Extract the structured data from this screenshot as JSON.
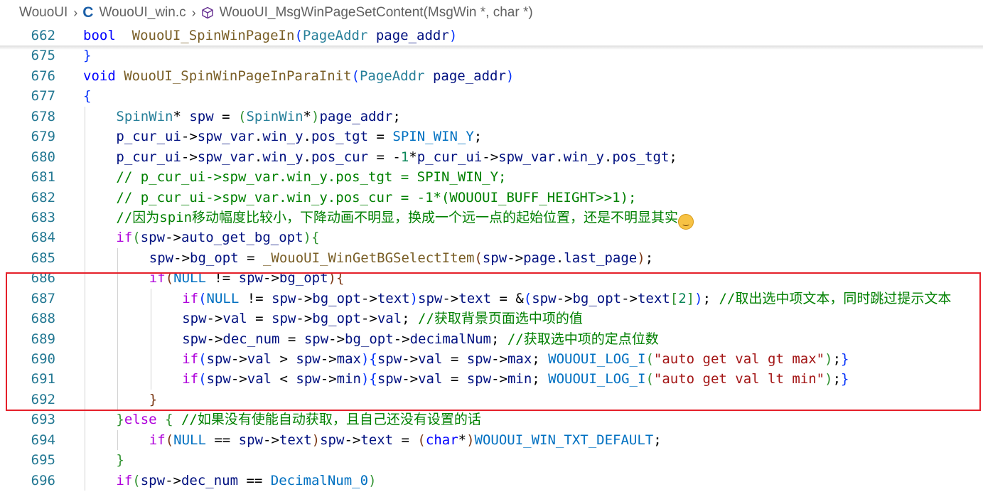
{
  "breadcrumb": {
    "folder": "WouoUI",
    "file": "WouoUI_win.c",
    "symbol": "WouoUI_MsgWinPageSetContent(MsgWin *, char *)"
  },
  "lines": [
    {
      "n": "662",
      "indent": 0,
      "tokens": [
        [
          "kw",
          "bool"
        ],
        [
          "",
          "  "
        ],
        [
          "fn",
          "WouoUI_SpinWinPageIn"
        ],
        [
          "b1",
          "("
        ],
        [
          "ty",
          "PageAddr"
        ],
        [
          "",
          " "
        ],
        [
          "var",
          "page_addr"
        ],
        [
          "b1",
          ")"
        ]
      ]
    },
    {
      "n": "675",
      "indent": 0,
      "tokens": [
        [
          "b1",
          "}"
        ]
      ]
    },
    {
      "n": "676",
      "indent": 0,
      "tokens": [
        [
          "kw",
          "void"
        ],
        [
          "",
          " "
        ],
        [
          "fn",
          "WouoUI_SpinWinPageInParaInit"
        ],
        [
          "b1",
          "("
        ],
        [
          "ty",
          "PageAddr"
        ],
        [
          "",
          " "
        ],
        [
          "var",
          "page_addr"
        ],
        [
          "b1",
          ")"
        ]
      ]
    },
    {
      "n": "677",
      "indent": 0,
      "tokens": [
        [
          "b1",
          "{"
        ]
      ]
    },
    {
      "n": "678",
      "indent": 1,
      "tokens": [
        [
          "ty",
          "SpinWin"
        ],
        [
          "",
          "* "
        ],
        [
          "var",
          "spw"
        ],
        [
          "",
          " = "
        ],
        [
          "b2",
          "("
        ],
        [
          "ty",
          "SpinWin"
        ],
        [
          "",
          "*"
        ],
        [
          "b2",
          ")"
        ],
        [
          "var",
          "page_addr"
        ],
        [
          "",
          ";"
        ]
      ]
    },
    {
      "n": "679",
      "indent": 1,
      "tokens": [
        [
          "var",
          "p_cur_ui"
        ],
        [
          "",
          "->"
        ],
        [
          "var",
          "spw_var"
        ],
        [
          "",
          "."
        ],
        [
          "var",
          "win_y"
        ],
        [
          "",
          "."
        ],
        [
          "var",
          "pos_tgt"
        ],
        [
          "",
          " = "
        ],
        [
          "mac",
          "SPIN_WIN_Y"
        ],
        [
          "",
          ";"
        ]
      ]
    },
    {
      "n": "680",
      "indent": 1,
      "tokens": [
        [
          "var",
          "p_cur_ui"
        ],
        [
          "",
          "->"
        ],
        [
          "var",
          "spw_var"
        ],
        [
          "",
          "."
        ],
        [
          "var",
          "win_y"
        ],
        [
          "",
          "."
        ],
        [
          "var",
          "pos_cur"
        ],
        [
          "",
          " = "
        ],
        [
          "",
          "-"
        ],
        [
          "num",
          "1"
        ],
        [
          "",
          "*"
        ],
        [
          "var",
          "p_cur_ui"
        ],
        [
          "",
          "->"
        ],
        [
          "var",
          "spw_var"
        ],
        [
          "",
          "."
        ],
        [
          "var",
          "win_y"
        ],
        [
          "",
          "."
        ],
        [
          "var",
          "pos_tgt"
        ],
        [
          "",
          ";"
        ]
      ]
    },
    {
      "n": "681",
      "indent": 1,
      "tokens": [
        [
          "cm",
          "// p_cur_ui->spw_var.win_y.pos_tgt = SPIN_WIN_Y;"
        ]
      ]
    },
    {
      "n": "682",
      "indent": 1,
      "tokens": [
        [
          "cm",
          "// p_cur_ui->spw_var.win_y.pos_cur = -1*(WOUOUI_BUFF_HEIGHT>>1);"
        ]
      ]
    },
    {
      "n": "683",
      "indent": 1,
      "tokens": [
        [
          "cm",
          "//因为spin移动幅度比较小，下降动画不明显，换成一个远一点的起始位置，还是不明显其实"
        ]
      ],
      "emoji": "face-with-tears-of-joy"
    },
    {
      "n": "684",
      "indent": 1,
      "tokens": [
        [
          "ctl",
          "if"
        ],
        [
          "b2",
          "("
        ],
        [
          "var",
          "spw"
        ],
        [
          "",
          "->"
        ],
        [
          "var",
          "auto_get_bg_opt"
        ],
        [
          "b2",
          ")"
        ],
        [
          "b2",
          "{"
        ]
      ]
    },
    {
      "n": "685",
      "indent": 2,
      "tokens": [
        [
          "var",
          "spw"
        ],
        [
          "",
          "->"
        ],
        [
          "var",
          "bg_opt"
        ],
        [
          "",
          " = "
        ],
        [
          "fn",
          "_WouoUI_WinGetBGSelectItem"
        ],
        [
          "b3",
          "("
        ],
        [
          "var",
          "spw"
        ],
        [
          "",
          "->"
        ],
        [
          "var",
          "page"
        ],
        [
          "",
          "."
        ],
        [
          "var",
          "last_page"
        ],
        [
          "b3",
          ")"
        ],
        [
          "",
          ";"
        ]
      ]
    },
    {
      "n": "686",
      "indent": 2,
      "tokens": [
        [
          "ctl",
          "if"
        ],
        [
          "b3",
          "("
        ],
        [
          "mac",
          "NULL"
        ],
        [
          "",
          " != "
        ],
        [
          "var",
          "spw"
        ],
        [
          "",
          "->"
        ],
        [
          "var",
          "bg_opt"
        ],
        [
          "b3",
          ")"
        ],
        [
          "b3",
          "{"
        ]
      ]
    },
    {
      "n": "687",
      "indent": 3,
      "tokens": [
        [
          "ctl",
          "if"
        ],
        [
          "b1",
          "("
        ],
        [
          "mac",
          "NULL"
        ],
        [
          "",
          " != "
        ],
        [
          "var",
          "spw"
        ],
        [
          "",
          "->"
        ],
        [
          "var",
          "bg_opt"
        ],
        [
          "",
          "->"
        ],
        [
          "var",
          "text"
        ],
        [
          "b1",
          ")"
        ],
        [
          "var",
          "spw"
        ],
        [
          "",
          "->"
        ],
        [
          "var",
          "text"
        ],
        [
          "",
          " = &"
        ],
        [
          "b1",
          "("
        ],
        [
          "var",
          "spw"
        ],
        [
          "",
          "->"
        ],
        [
          "var",
          "bg_opt"
        ],
        [
          "",
          "->"
        ],
        [
          "var",
          "text"
        ],
        [
          "b2",
          "["
        ],
        [
          "num",
          "2"
        ],
        [
          "b2",
          "]"
        ],
        [
          "b1",
          ")"
        ],
        [
          "",
          "; "
        ],
        [
          "cm",
          "//取出选中项文本，同时跳过提示文本"
        ]
      ]
    },
    {
      "n": "688",
      "indent": 3,
      "tokens": [
        [
          "var",
          "spw"
        ],
        [
          "",
          "->"
        ],
        [
          "var",
          "val"
        ],
        [
          "",
          " = "
        ],
        [
          "var",
          "spw"
        ],
        [
          "",
          "->"
        ],
        [
          "var",
          "bg_opt"
        ],
        [
          "",
          "->"
        ],
        [
          "var",
          "val"
        ],
        [
          "",
          "; "
        ],
        [
          "cm",
          "//获取背景页面选中项的值"
        ]
      ]
    },
    {
      "n": "689",
      "indent": 3,
      "tokens": [
        [
          "var",
          "spw"
        ],
        [
          "",
          "->"
        ],
        [
          "var",
          "dec_num"
        ],
        [
          "",
          " = "
        ],
        [
          "var",
          "spw"
        ],
        [
          "",
          "->"
        ],
        [
          "var",
          "bg_opt"
        ],
        [
          "",
          "->"
        ],
        [
          "var",
          "decimalNum"
        ],
        [
          "",
          "; "
        ],
        [
          "cm",
          "//获取选中项的定点位数"
        ]
      ]
    },
    {
      "n": "690",
      "indent": 3,
      "tokens": [
        [
          "ctl",
          "if"
        ],
        [
          "b1",
          "("
        ],
        [
          "var",
          "spw"
        ],
        [
          "",
          "->"
        ],
        [
          "var",
          "val"
        ],
        [
          "",
          " > "
        ],
        [
          "var",
          "spw"
        ],
        [
          "",
          "->"
        ],
        [
          "var",
          "max"
        ],
        [
          "b1",
          ")"
        ],
        [
          "b1",
          "{"
        ],
        [
          "var",
          "spw"
        ],
        [
          "",
          "->"
        ],
        [
          "var",
          "val"
        ],
        [
          "",
          " = "
        ],
        [
          "var",
          "spw"
        ],
        [
          "",
          "->"
        ],
        [
          "var",
          "max"
        ],
        [
          "",
          "; "
        ],
        [
          "mac",
          "WOUOUI_LOG_I"
        ],
        [
          "b2",
          "("
        ],
        [
          "str",
          "\"auto get val gt max\""
        ],
        [
          "b2",
          ")"
        ],
        [
          "",
          ";"
        ],
        [
          "b1",
          "}"
        ]
      ]
    },
    {
      "n": "691",
      "indent": 3,
      "tokens": [
        [
          "ctl",
          "if"
        ],
        [
          "b1",
          "("
        ],
        [
          "var",
          "spw"
        ],
        [
          "",
          "->"
        ],
        [
          "var",
          "val"
        ],
        [
          "",
          " < "
        ],
        [
          "var",
          "spw"
        ],
        [
          "",
          "->"
        ],
        [
          "var",
          "min"
        ],
        [
          "b1",
          ")"
        ],
        [
          "b1",
          "{"
        ],
        [
          "var",
          "spw"
        ],
        [
          "",
          "->"
        ],
        [
          "var",
          "val"
        ],
        [
          "",
          " = "
        ],
        [
          "var",
          "spw"
        ],
        [
          "",
          "->"
        ],
        [
          "var",
          "min"
        ],
        [
          "",
          "; "
        ],
        [
          "mac",
          "WOUOUI_LOG_I"
        ],
        [
          "b2",
          "("
        ],
        [
          "str",
          "\"auto get val lt min\""
        ],
        [
          "b2",
          ")"
        ],
        [
          "",
          ";"
        ],
        [
          "b1",
          "}"
        ]
      ]
    },
    {
      "n": "692",
      "indent": 2,
      "tokens": [
        [
          "b3",
          "}"
        ]
      ]
    },
    {
      "n": "693",
      "indent": 1,
      "tokens": [
        [
          "b2",
          "}"
        ],
        [
          "ctl",
          "else"
        ],
        [
          "",
          " "
        ],
        [
          "b2",
          "{"
        ],
        [
          "",
          " "
        ],
        [
          "cm",
          "//如果没有使能自动获取，且自己还没有设置的话"
        ]
      ]
    },
    {
      "n": "694",
      "indent": 2,
      "tokens": [
        [
          "ctl",
          "if"
        ],
        [
          "b3",
          "("
        ],
        [
          "mac",
          "NULL"
        ],
        [
          "",
          " == "
        ],
        [
          "var",
          "spw"
        ],
        [
          "",
          "->"
        ],
        [
          "var",
          "text"
        ],
        [
          "b3",
          ")"
        ],
        [
          "var",
          "spw"
        ],
        [
          "",
          "->"
        ],
        [
          "var",
          "text"
        ],
        [
          "",
          " = "
        ],
        [
          "b3",
          "("
        ],
        [
          "kw",
          "char"
        ],
        [
          "",
          "*"
        ],
        [
          "b3",
          ")"
        ],
        [
          "mac",
          "WOUOUI_WIN_TXT_DEFAULT"
        ],
        [
          "",
          ";"
        ]
      ]
    },
    {
      "n": "695",
      "indent": 1,
      "tokens": [
        [
          "b2",
          "}"
        ]
      ]
    },
    {
      "n": "696",
      "indent": 1,
      "tokens": [
        [
          "ctl",
          "if"
        ],
        [
          "b2",
          "("
        ],
        [
          "var",
          "spw"
        ],
        [
          "",
          "->"
        ],
        [
          "var",
          "dec_num"
        ],
        [
          "",
          " == "
        ],
        [
          "mac",
          "DecimalNum_0"
        ],
        [
          "b2",
          ")"
        ]
      ]
    }
  ]
}
